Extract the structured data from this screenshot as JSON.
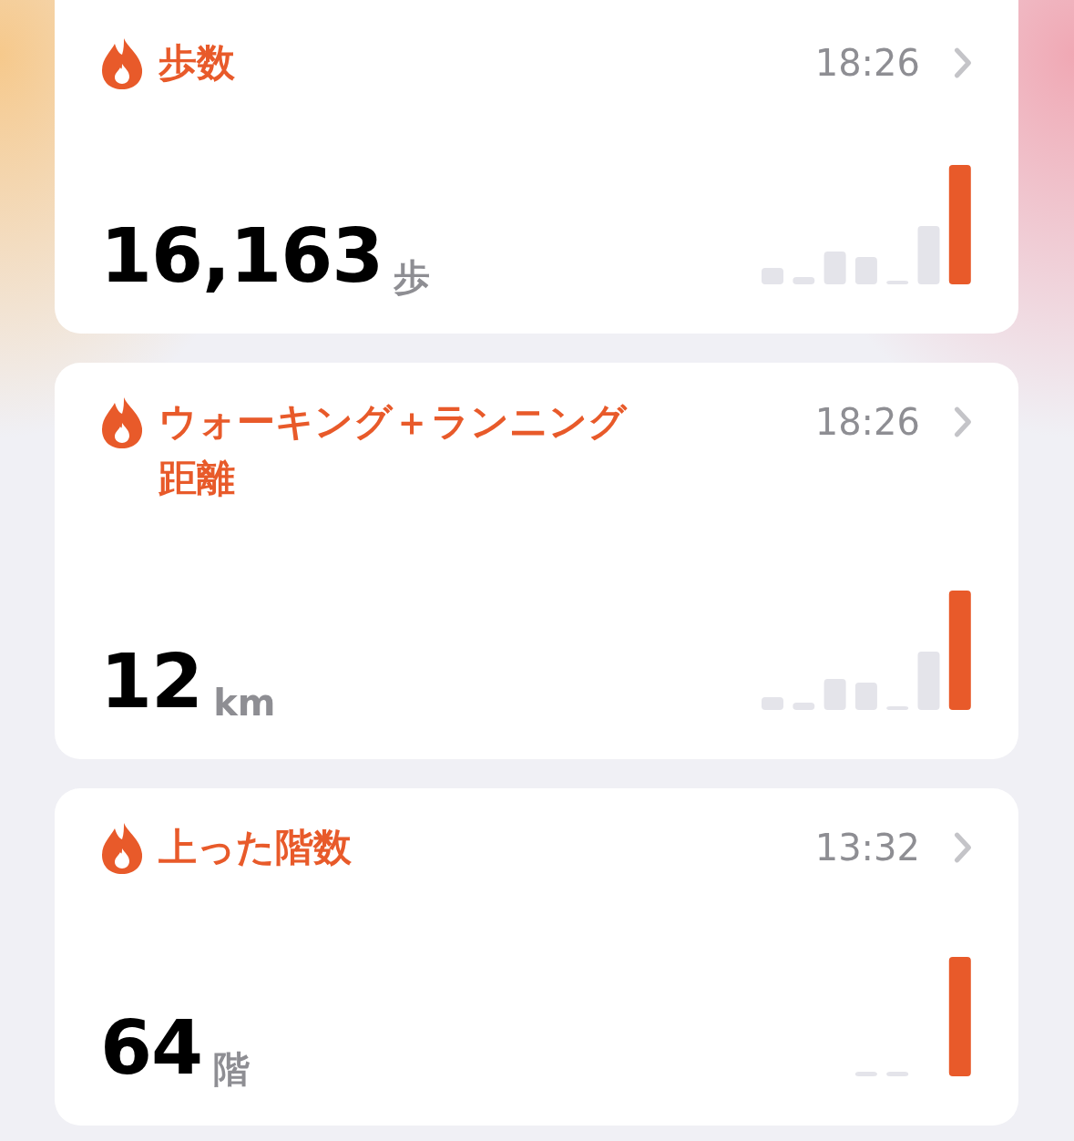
{
  "cards": [
    {
      "title": "歩数",
      "time": "18:26",
      "value": "16,163",
      "unit": "歩"
    },
    {
      "title": "ウォーキング＋ランニング距離",
      "time": "18:26",
      "value": "12",
      "unit": "km"
    },
    {
      "title": "上った階数",
      "time": "13:32",
      "value": "64",
      "unit": "階"
    }
  ]
}
